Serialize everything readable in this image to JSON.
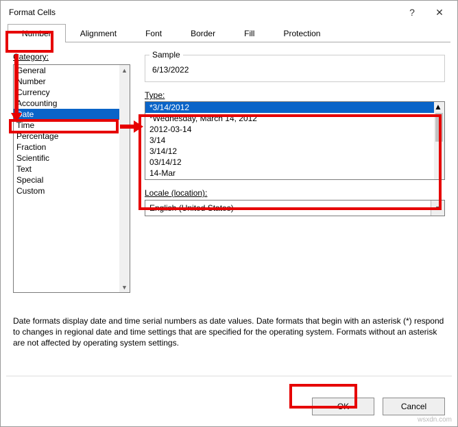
{
  "title": "Format Cells",
  "titlebar": {
    "help": "?",
    "close": "✕"
  },
  "tabs": {
    "number": "Number",
    "alignment": "Alignment",
    "font": "Font",
    "border": "Border",
    "fill": "Fill",
    "protection": "Protection"
  },
  "category_label": "Category:",
  "categories": {
    "general": "General",
    "number": "Number",
    "currency": "Currency",
    "accounting": "Accounting",
    "date": "Date",
    "time": "Time",
    "percentage": "Percentage",
    "fraction": "Fraction",
    "scientific": "Scientific",
    "text": "Text",
    "special": "Special",
    "custom": "Custom"
  },
  "sample": {
    "legend": "Sample",
    "value": "6/13/2022"
  },
  "type_label": "Type:",
  "types": {
    "t0": "*3/14/2012",
    "t1": "*Wednesday, March 14, 2012",
    "t2": "2012-03-14",
    "t3": "3/14",
    "t4": "3/14/12",
    "t5": "03/14/12",
    "t6": "14-Mar"
  },
  "locale_label": "Locale (location):",
  "locale_value": "English (United States)",
  "description": "Date formats display date and time serial numbers as date values.  Date formats that begin with an asterisk (*) respond to changes in regional date and time settings that are specified for the operating system.  Formats without an asterisk are not affected by operating system settings.",
  "buttons": {
    "ok": "OK",
    "cancel": "Cancel"
  },
  "watermark": "wsxdn.com"
}
